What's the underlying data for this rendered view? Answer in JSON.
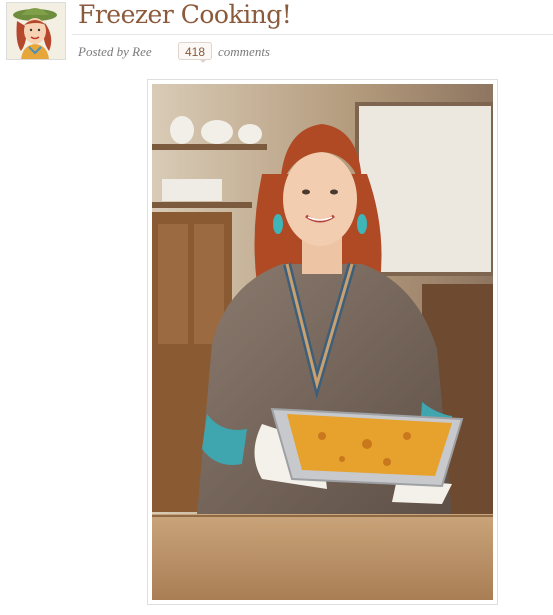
{
  "post": {
    "title": "Freezer Cooking!",
    "posted_by": "Posted by Ree",
    "comment_count": "418",
    "comments_label": "comments"
  },
  "icons": {
    "avatar": "cowgirl-avatar-icon"
  },
  "colors": {
    "title": "#8b5a3c",
    "meta_text": "#7a7a7a",
    "badge_border": "#e0d4cc"
  }
}
